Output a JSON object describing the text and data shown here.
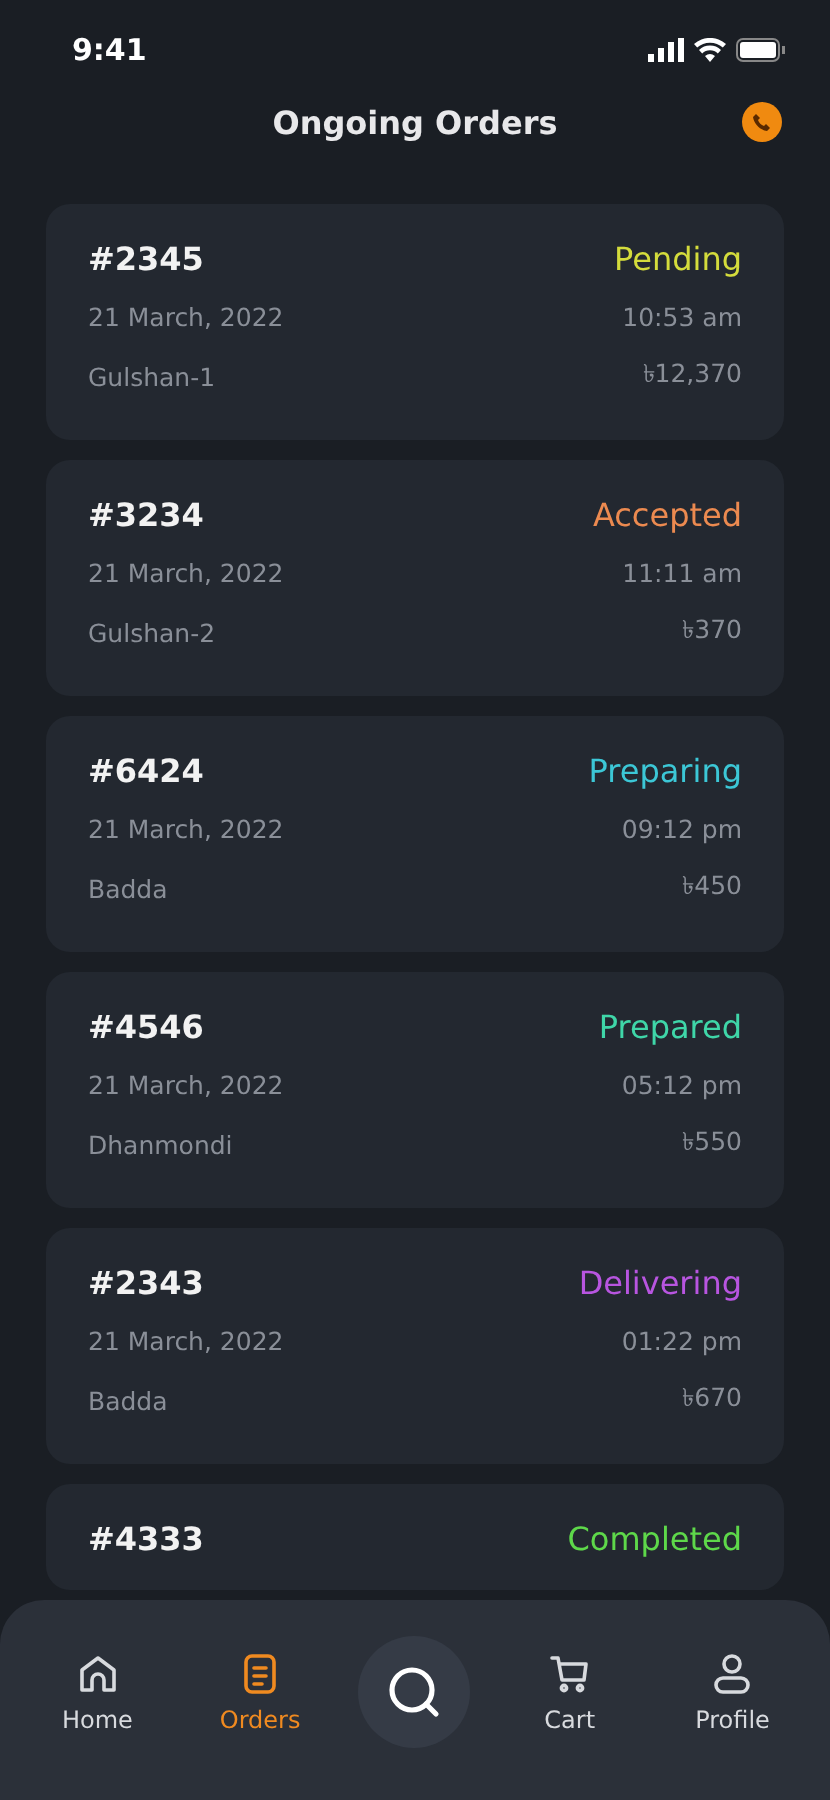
{
  "status_bar": {
    "time": "9:41"
  },
  "header": {
    "title": "Ongoing Orders"
  },
  "orders": [
    {
      "id": "#2345",
      "status": "Pending",
      "color": "#d4dc3c",
      "date": "21 March, 2022",
      "time": "10:53 am",
      "area": "Gulshan-1",
      "amount": "৳12,370"
    },
    {
      "id": "#3234",
      "status": "Accepted",
      "color": "#ec8a50",
      "date": "21 March, 2022",
      "time": "11:11 am",
      "area": "Gulshan-2",
      "amount": "৳370"
    },
    {
      "id": "#6424",
      "status": "Preparing",
      "color": "#3cc7d6",
      "date": "21 March, 2022",
      "time": "09:12 pm",
      "area": "Badda",
      "amount": "৳450"
    },
    {
      "id": "#4546",
      "status": "Prepared",
      "color": "#3fd6a8",
      "date": "21 March, 2022",
      "time": "05:12 pm",
      "area": "Dhanmondi",
      "amount": "৳550"
    },
    {
      "id": "#2343",
      "status": "Delivering",
      "color": "#b855e0",
      "date": "21 March, 2022",
      "time": "01:22 pm",
      "area": "Badda",
      "amount": "৳670"
    },
    {
      "id": "#4333",
      "status": "Completed",
      "color": "#5ed84a"
    }
  ],
  "nav": [
    {
      "kind": "home",
      "label": "Home",
      "selected": false
    },
    {
      "kind": "orders",
      "label": "Orders",
      "selected": true
    },
    {
      "kind": "search"
    },
    {
      "kind": "cart",
      "label": "Cart",
      "selected": false
    },
    {
      "kind": "profile",
      "label": "Profile",
      "selected": false
    }
  ]
}
